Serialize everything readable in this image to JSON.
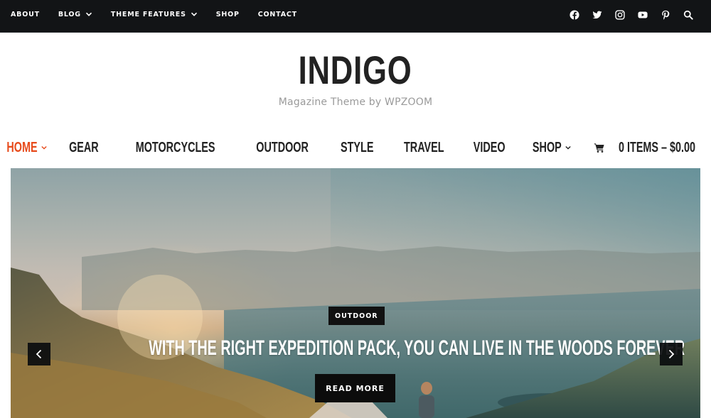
{
  "topbar": {
    "nav": [
      {
        "label": "ABOUT",
        "has_dropdown": false
      },
      {
        "label": "BLOG",
        "has_dropdown": true
      },
      {
        "label": "THEME FEATURES",
        "has_dropdown": true
      },
      {
        "label": "SHOP",
        "has_dropdown": false
      },
      {
        "label": "CONTACT",
        "has_dropdown": false
      }
    ],
    "social": [
      "facebook-icon",
      "twitter-icon",
      "instagram-icon",
      "youtube-icon",
      "pinterest-icon",
      "search-icon"
    ]
  },
  "brand": {
    "title": "INDIGO",
    "tagline": "Magazine Theme by WPZOOM"
  },
  "mainnav": {
    "items": [
      {
        "label": "HOME",
        "active": true,
        "has_dropdown": true
      },
      {
        "label": "GEAR",
        "active": false,
        "has_dropdown": false
      },
      {
        "label": "MOTORCYCLES",
        "active": false,
        "has_dropdown": false
      },
      {
        "label": "OUTDOOR",
        "active": false,
        "has_dropdown": false
      },
      {
        "label": "STYLE",
        "active": false,
        "has_dropdown": false
      },
      {
        "label": "TRAVEL",
        "active": false,
        "has_dropdown": false
      },
      {
        "label": "VIDEO",
        "active": false,
        "has_dropdown": false
      },
      {
        "label": "SHOP",
        "active": false,
        "has_dropdown": true
      }
    ],
    "cart_label": "0 ITEMS – $0.00"
  },
  "slider": {
    "category": "OUTDOOR",
    "title": "WITH THE RIGHT EXPEDITION PACK, YOU CAN LIVE IN THE WOODS FOREVER",
    "button_label": "READ MORE",
    "prev_icon": "chevron-left-icon",
    "next_icon": "chevron-right-icon"
  },
  "colors": {
    "accent": "#e74b1c",
    "topbar_bg": "#121416",
    "text_dark": "#222222",
    "tagline": "#9a9a9a"
  }
}
